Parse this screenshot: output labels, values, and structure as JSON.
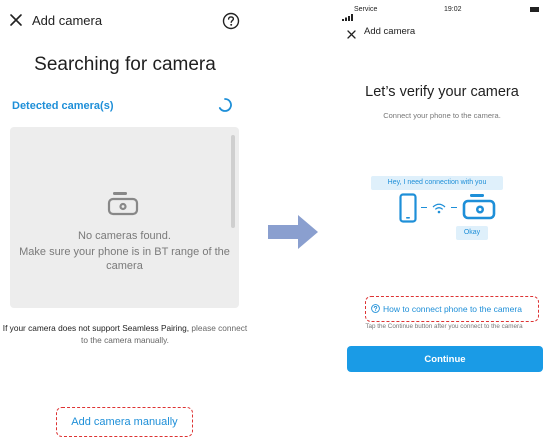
{
  "left": {
    "header": {
      "title": "Add camera",
      "close_icon": "close-icon",
      "help_icon": "help-circle-icon"
    },
    "heading": "Searching for camera",
    "detected_label": "Detected camera(s)",
    "spinner_icon": "loading-spinner-icon",
    "empty_state": {
      "icon": "camera-icon",
      "line1": "No cameras found.",
      "line2": "Make sure your phone is in BT range of the camera"
    },
    "support_note": {
      "prefix": "If your camera does not support Seamless Pairing,",
      "suffix": "please connect to the camera manually."
    },
    "manual_link": "Add camera manually"
  },
  "arrow_icon": "right-arrow-icon",
  "right": {
    "status_bar": {
      "carrier": "Service",
      "time": "19:02",
      "signal_icon": "signal-icon",
      "battery_icon": "battery-icon"
    },
    "header": {
      "title": "Add camera",
      "close_icon": "close-icon"
    },
    "heading": "Let’s verify your camera",
    "subheading": "Connect your phone to the camera.",
    "illustration": {
      "bubble_phone": "Hey, I need connection with you",
      "bubble_camera": "Okay",
      "icons": [
        "phone-icon",
        "wifi-icon",
        "camera-icon"
      ]
    },
    "help_link": "How to connect phone to the camera",
    "tap_hint": "Tap the Continue button after you connect to the camera",
    "continue_label": "Continue"
  },
  "colors": {
    "accent": "#1e8fd8",
    "button": "#1a9be6",
    "highlight": "#dd3333",
    "panel": "#ededed",
    "arrow": "#8a9fcf"
  }
}
